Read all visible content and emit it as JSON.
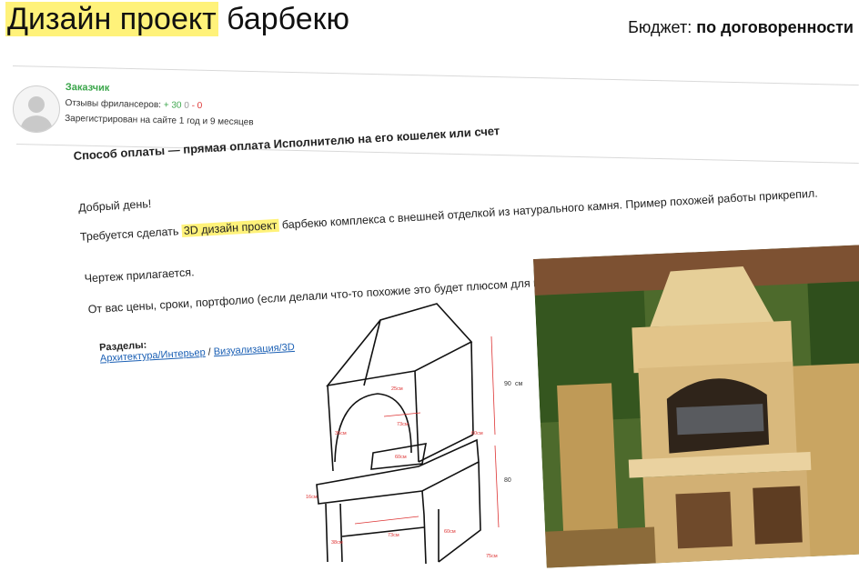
{
  "project": {
    "title_highlight": "Дизайн проект",
    "title_rest": "барбекю",
    "budget_label": "Бюджет:",
    "budget_value": "по договоренности"
  },
  "client": {
    "role": "Заказчик",
    "reviews_label": "Отзывы фрилансеров:",
    "reviews_positive": "+ 30",
    "reviews_neutral": "0",
    "reviews_negative": "- 0",
    "registered": "Зарегистрирован на сайте 1 год и 9 месяцев"
  },
  "payment": "Способ оплаты — прямая оплата Исполнителю на его кошелек или счет",
  "description": {
    "greeting": "Добрый день!",
    "line1_before": "Требуется сделать",
    "line1_highlight": "3D дизайн проект",
    "line1_after": "барбекю комплекса с внешней отделкой из натурального камня. Пример похожей работы прикрепил.",
    "line2": "Чертеж прилагается.",
    "line3": "От вас цены, сроки, портфолио (если делали что-то похожие это будет плюсом для вас)"
  },
  "sections": {
    "heading": "Разделы:",
    "link1": "Архитектура/Интерьер",
    "separator": "/",
    "link2": "Визуализация/3D"
  },
  "drawing_labels": {
    "top_width": "25см",
    "arch_width": "73см",
    "side_depth": "60см",
    "left_depth": "36см",
    "opening": "60см",
    "height_top": "90",
    "height_unit": "см",
    "height_bottom": "80",
    "slab": "16см",
    "base_width": "73см",
    "base_left": "38см",
    "base_right": "60см",
    "bottom": "75см"
  },
  "colors": {
    "highlight": "#fff27a",
    "positive": "#3ba64b",
    "negative": "#dd3333",
    "link": "#1a5fb4"
  }
}
